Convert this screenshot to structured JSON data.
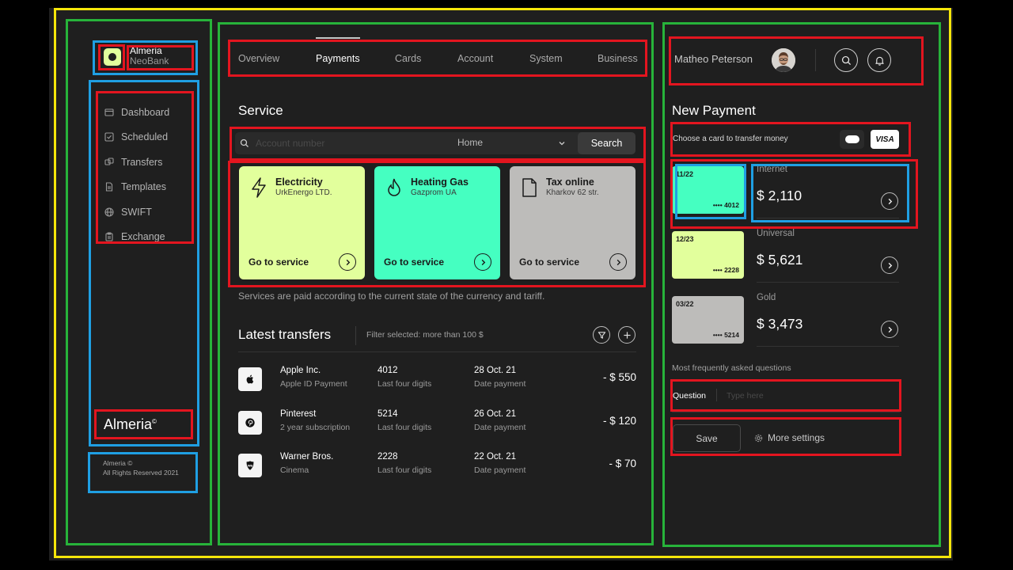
{
  "brand": {
    "name": "Almeria",
    "sub": "NeoBank",
    "logo_text": "Almeria",
    "logo_mark": "©",
    "copyright_line1": "Almeria ©",
    "copyright_line2": "All Rights Reserved 2021"
  },
  "sidebar": {
    "items": [
      {
        "label": "Dashboard",
        "icon": "dashboard-icon"
      },
      {
        "label": "Scheduled",
        "icon": "checkbox-icon"
      },
      {
        "label": "Transfers",
        "icon": "transfer-icon"
      },
      {
        "label": "Templates",
        "icon": "document-icon"
      },
      {
        "label": "SWIFT",
        "icon": "globe-icon"
      },
      {
        "label": "Exchange",
        "icon": "clipboard-icon"
      }
    ]
  },
  "tabs": [
    {
      "label": "Overview",
      "active": false
    },
    {
      "label": "Payments",
      "active": true
    },
    {
      "label": "Cards",
      "active": false
    },
    {
      "label": "Account",
      "active": false
    },
    {
      "label": "System",
      "active": false
    },
    {
      "label": "Business",
      "active": false
    }
  ],
  "service": {
    "title": "Service",
    "search": {
      "placeholder": "Account number",
      "select_value": "Home",
      "button_label": "Search"
    },
    "cards": [
      {
        "title": "Electricity",
        "subtitle": "UrkEnergo LTD.",
        "action": "Go to service",
        "color": "#e2ff9c",
        "icon": "lightning-icon"
      },
      {
        "title": "Heating Gas",
        "subtitle": "Gazprom UA",
        "action": "Go to service",
        "color": "#45ffc1",
        "icon": "flame-icon"
      },
      {
        "title": "Tax online",
        "subtitle": "Kharkov 62 str.",
        "action": "Go to service",
        "color": "#bdbcba",
        "icon": "file-icon"
      }
    ],
    "note": "Services are paid according to the current state of the currency and tariff."
  },
  "transfers": {
    "title": "Latest transfers",
    "filter": "Filter selected: more than 100 $",
    "rows": [
      {
        "name": "Apple Inc.",
        "desc": "Apple ID Payment",
        "digits": "4012",
        "digits_label": "Last four digits",
        "date": "28 Oct. 21",
        "date_label": "Date payment",
        "amount": "- $ 550",
        "icon": "apple-icon"
      },
      {
        "name": "Pinterest",
        "desc": "2 year subscription",
        "digits": "5214",
        "digits_label": "Last four digits",
        "date": "26 Oct. 21",
        "date_label": "Date payment",
        "amount": "- $ 120",
        "icon": "pinterest-icon"
      },
      {
        "name": "Warner Bros.",
        "desc": "Cinema",
        "digits": "2228",
        "digits_label": "Last four digits",
        "date": "22 Oct. 21",
        "date_label": "Date payment",
        "amount": "- $ 70",
        "icon": "warner-bros-icon"
      }
    ]
  },
  "user": {
    "name": "Matheo Peterson"
  },
  "new_payment": {
    "title": "New Payment",
    "choose_text": "Choose a card to transfer money",
    "visa_label": "VISA",
    "cards": [
      {
        "date": "11/22",
        "number": "•••• 4012",
        "label": "Internet",
        "amount": "$ 2,110",
        "color": "#45ffc1"
      },
      {
        "date": "12/23",
        "number": "•••• 2228",
        "label": "Universal",
        "amount": "$ 5,621",
        "color": "#e2ff9c"
      },
      {
        "date": "03/22",
        "number": "•••• 5214",
        "label": "Gold",
        "amount": "$ 3,473",
        "color": "#bdbcba"
      }
    ],
    "faq": "Most frequently asked questions",
    "question_label": "Question",
    "question_placeholder": "Type here",
    "save_label": "Save",
    "more_label": "More settings"
  }
}
